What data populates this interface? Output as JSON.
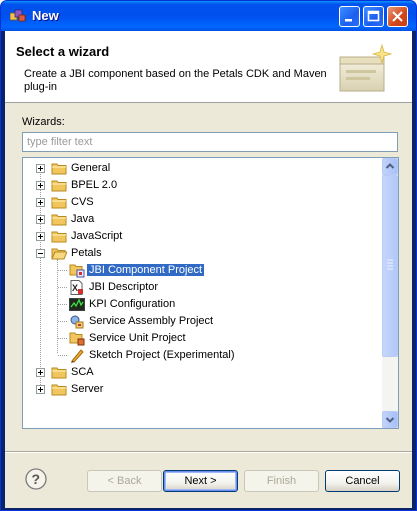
{
  "window": {
    "title": "New"
  },
  "banner": {
    "title": "Select a wizard",
    "description": "Create a JBI component based on the Petals CDK and Maven plug-in"
  },
  "wizards_label": "Wizards:",
  "filter": {
    "placeholder": "type filter text",
    "value": ""
  },
  "tree": {
    "items": [
      {
        "label": "General",
        "type": "folder",
        "expanded": false,
        "level": 0
      },
      {
        "label": "BPEL 2.0",
        "type": "folder",
        "expanded": false,
        "level": 0
      },
      {
        "label": "CVS",
        "type": "folder",
        "expanded": false,
        "level": 0
      },
      {
        "label": "Java",
        "type": "folder",
        "expanded": false,
        "level": 0
      },
      {
        "label": "JavaScript",
        "type": "folder",
        "expanded": false,
        "level": 0
      },
      {
        "label": "Petals",
        "type": "folder",
        "expanded": true,
        "level": 0
      },
      {
        "label": "JBI Component Project",
        "type": "wizard",
        "icon": "jbi-component-icon",
        "level": 1,
        "selected": true
      },
      {
        "label": "JBI Descriptor",
        "type": "wizard",
        "icon": "jbi-descriptor-icon",
        "level": 1
      },
      {
        "label": "KPI Configuration",
        "type": "wizard",
        "icon": "kpi-icon",
        "level": 1
      },
      {
        "label": "Service Assembly Project",
        "type": "wizard",
        "icon": "service-assembly-icon",
        "level": 1
      },
      {
        "label": "Service Unit Project",
        "type": "wizard",
        "icon": "service-unit-icon",
        "level": 1
      },
      {
        "label": "Sketch Project (Experimental)",
        "type": "wizard",
        "icon": "sketch-icon",
        "level": 1
      },
      {
        "label": "SCA",
        "type": "folder",
        "expanded": false,
        "level": 0
      },
      {
        "label": "Server",
        "type": "folder",
        "expanded": false,
        "level": 0
      }
    ]
  },
  "buttons": {
    "back": "< Back",
    "next": "Next >",
    "finish": "Finish",
    "cancel": "Cancel"
  },
  "colors": {
    "selection": "#316ac5",
    "titlebar": "#0053ee",
    "dialog_bg": "#ece9d8"
  }
}
